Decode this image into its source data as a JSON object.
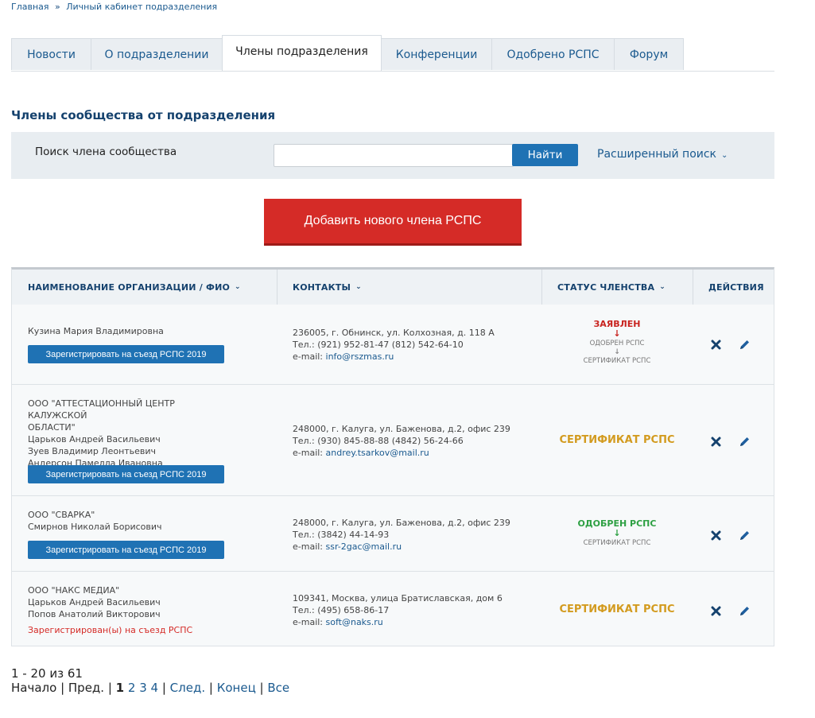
{
  "breadcrumb": {
    "home": "Главная",
    "separator": "»",
    "current": "Личный кабинет подразделения"
  },
  "tabs": [
    "Новости",
    "О подразделении",
    "Члены подразделения",
    "Конференции",
    "Одобрено РСПС",
    "Форум"
  ],
  "active_tab": "Члены подразделения",
  "section_title": "Члены сообщества от подразделения",
  "search": {
    "label": "Поиск члена сообщества",
    "value": "",
    "button": "Найти",
    "advanced": "Расширенный поиск"
  },
  "add_button": "Добавить нового члена РСПС",
  "table": {
    "headers": {
      "org": "НАИМЕНОВАНИЕ ОРГАНИЗАЦИИ / ФИО",
      "contacts": "КОНТАКТЫ",
      "status": "СТАТУС ЧЛЕНСТВА",
      "actions": "ДЕЙСТВИЯ"
    },
    "register_label": "Зарегистрировать на съезд РСПС 2019",
    "registered_label": "Зарегистрирован(ы) на съезд РСПС",
    "rows": [
      {
        "org_lines": [
          "Кузина Мария Владимировна"
        ],
        "address": "236005, г. Обнинск, ул. Колхозная, д. 118 А",
        "phone": "Тел.: (921) 952-81-47 (812) 542-64-10",
        "email_prefix": "e-mail: ",
        "email": "info@rszmas.ru",
        "status_main": "ЗАЯВЛЕН",
        "status_steps": [
          "ОДОБРЕН РСПС",
          "СЕРТИФИКАТ РСПС"
        ]
      },
      {
        "org_lines": [
          "ООО \"АТТЕСТАЦИОННЫЙ ЦЕНТР КАЛУЖСКОЙ",
          "ОБЛАСТИ\"",
          "Царьков Андрей Васильевич",
          "Зуев Владимир Леонтьевич",
          "Андерсон Памелла Ивановна"
        ],
        "address": "248000, г. Калуга, ул. Баженова, д.2, офис 239",
        "phone": "Тел.: (930) 845-88-88 (4842) 56-24-66",
        "email_prefix": "e-mail: ",
        "email": "andrey.tsarkov@mail.ru",
        "status_main": "СЕРТИФИКАТ РСПС"
      },
      {
        "org_lines": [
          "ООО \"СВАРКА\"",
          "Смирнов Николай Борисович"
        ],
        "address": "248000, г. Калуга, ул. Баженова, д.2, офис 239",
        "phone": "Тел.: (3842) 44-14-93",
        "email_prefix": "e-mail: ",
        "email": "ssr-2gac@mail.ru",
        "status_main": "ОДОБРЕН РСПС",
        "status_steps": [
          "СЕРТИФИКАТ РСПС"
        ]
      },
      {
        "org_lines": [
          "ООО \"НАКС МЕДИА\"",
          "Царьков Андрей Васильевич",
          "Попов Анатолий Викторович"
        ],
        "address": "109341, Москва, улица Братиславская, дом 6",
        "phone": "Тел.: (495) 658-86-17",
        "email_prefix": "e-mail: ",
        "email": "soft@naks.ru",
        "status_main": "СЕРТИФИКАТ РСПС"
      }
    ]
  },
  "pager": {
    "count": "1 - 20 из 61",
    "start": "Начало",
    "prev": "Пред.",
    "current": "1",
    "pages": [
      "2",
      "3",
      "4"
    ],
    "next": "След.",
    "end": "Конец",
    "all": "Все"
  },
  "colors": {
    "accent": "#1f72b4",
    "danger": "#d52b27",
    "gold": "#d39b1f",
    "green": "#2ea043"
  }
}
